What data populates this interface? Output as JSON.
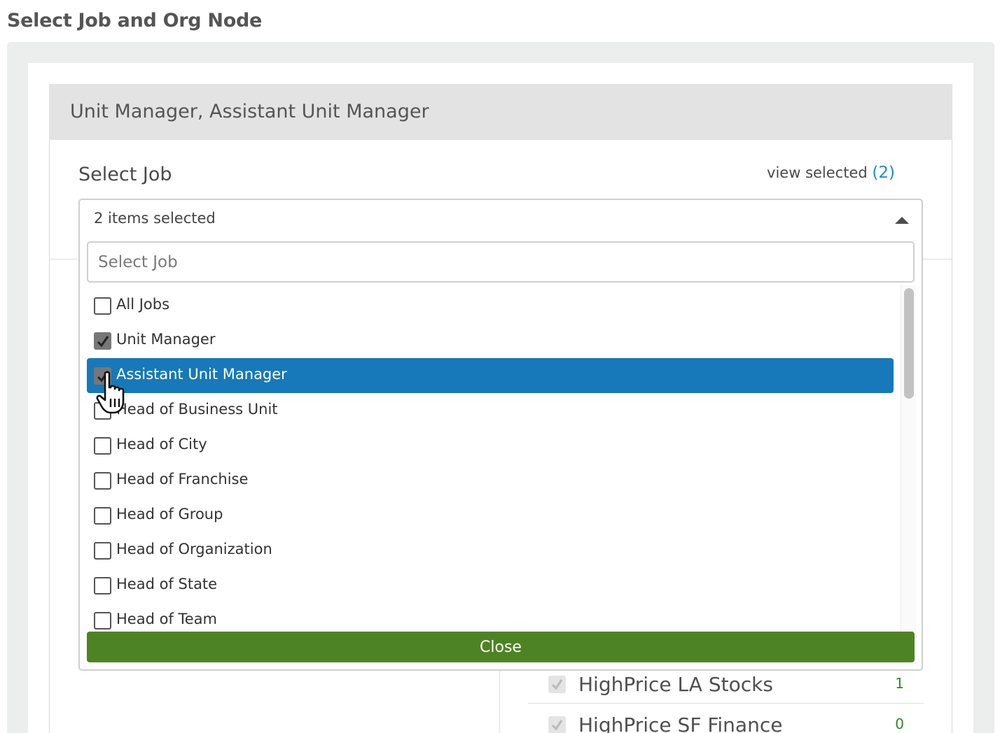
{
  "page": {
    "heading": "Select Job and Org Node"
  },
  "selection": {
    "title": "Unit Manager, Assistant Unit Manager"
  },
  "job_field": {
    "label": "Select Job",
    "view_selected_label": "view selected",
    "view_selected_count": "(2)"
  },
  "dropdown": {
    "value": "2 items selected",
    "search_placeholder": "Select Job",
    "close_label": "Close",
    "options": [
      {
        "label": "All Jobs",
        "checked": false
      },
      {
        "label": "Unit Manager",
        "checked": true
      },
      {
        "label": "Assistant Unit Manager",
        "checked": true,
        "highlighted": true
      },
      {
        "label": "Head of Business Unit",
        "checked": false
      },
      {
        "label": "Head of City",
        "checked": false
      },
      {
        "label": "Head of Franchise",
        "checked": false
      },
      {
        "label": "Head of Group",
        "checked": false
      },
      {
        "label": "Head of Organization",
        "checked": false
      },
      {
        "label": "Head of State",
        "checked": false
      },
      {
        "label": "Head of Team",
        "checked": false
      }
    ]
  },
  "org_nodes": [
    {
      "name": "HighPrice LA Stocks",
      "count": "1",
      "checked": true
    },
    {
      "name": "HighPrice SF Finance",
      "count": "0",
      "checked": true
    }
  ],
  "colors": {
    "highlight": "#1779b9",
    "close_button": "#4e8323",
    "link": "#1a8ccf",
    "count_green": "#2a8a21"
  }
}
